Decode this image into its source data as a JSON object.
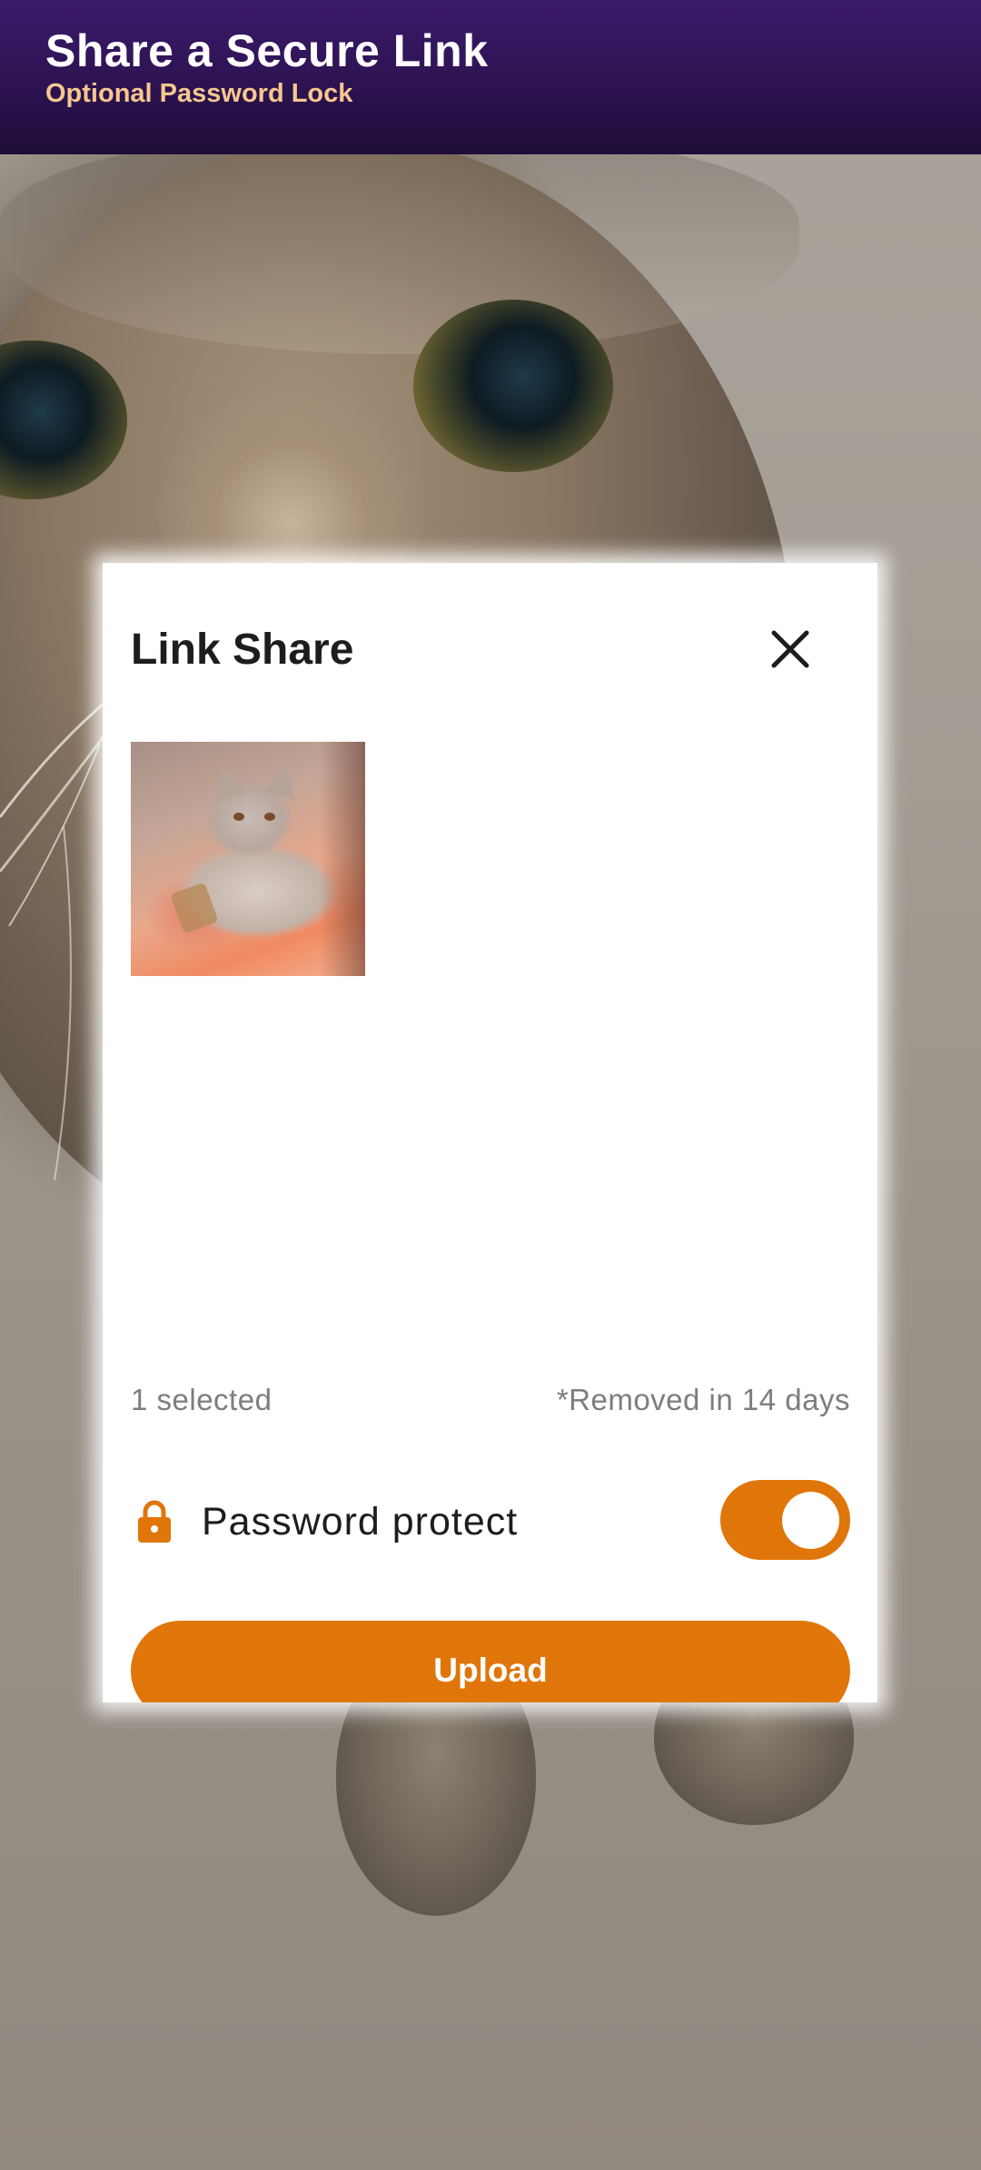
{
  "header": {
    "title": "Share a Secure Link",
    "subtitle": "Optional Password Lock"
  },
  "background": {
    "description_icon": "cat-photo"
  },
  "dialog": {
    "title": "Link Share",
    "close_icon": "close-icon",
    "thumbnail_icon": "kitten-photo-thumbnail",
    "selected_count": "1 selected",
    "removal_note": "*Removed in 14 days",
    "password_label": "Password protect",
    "password_icon": "lock-icon",
    "password_enabled": true,
    "upload_label": "Upload"
  },
  "colors": {
    "accent": "#e07609",
    "header_bg": "#2b124f",
    "header_subtitle": "#f6c78f"
  }
}
